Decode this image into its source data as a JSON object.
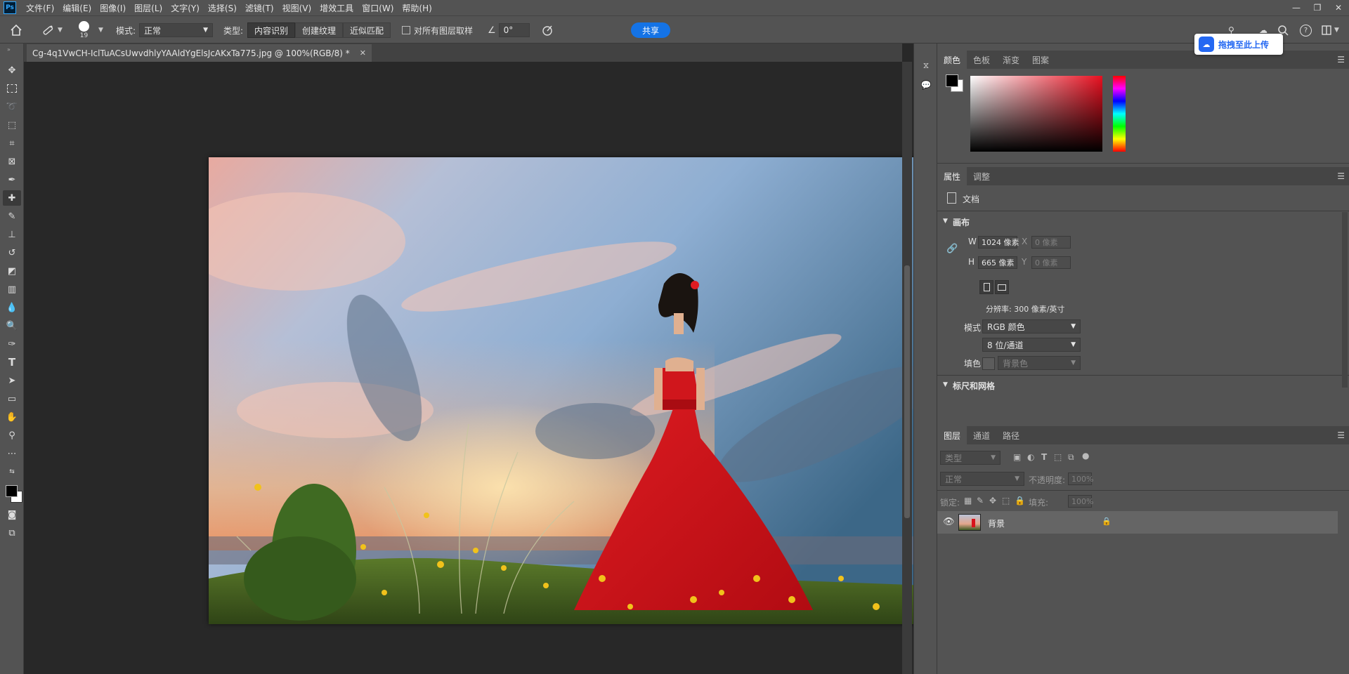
{
  "app": {
    "logo": "Ps"
  },
  "menu": [
    "文件(F)",
    "编辑(E)",
    "图像(I)",
    "图层(L)",
    "文字(Y)",
    "选择(S)",
    "滤镜(T)",
    "视图(V)",
    "增效工具",
    "窗口(W)",
    "帮助(H)"
  ],
  "window_controls": {
    "minimize": "—",
    "restore": "❐",
    "close": "✕"
  },
  "options": {
    "brush_size": "19",
    "mode_label": "模式:",
    "mode_value": "正常",
    "type_label": "类型:",
    "type_buttons": [
      "内容识别",
      "创建纹理",
      "近似匹配"
    ],
    "sample_all_label": "对所有图层取样",
    "angle_value": "0°",
    "share_label": "共享"
  },
  "document": {
    "tab_title": "Cg-4q1VwCH-IclTuACsUwvdhlyYAAldYgElsJcAKxTa775.jpg @ 100%(RGB/8) *",
    "close_glyph": "✕"
  },
  "overlay": {
    "baidu_label": "拖拽至此上传"
  },
  "color_panel": {
    "tabs": [
      "颜色",
      "色板",
      "渐变",
      "图案"
    ],
    "foreground": "#000000",
    "background": "#ffffff"
  },
  "properties_panel": {
    "tabs": [
      "属性",
      "调整"
    ],
    "doc_label": "文档",
    "canvas_section": "画布",
    "w_label": "W",
    "w_value": "1024 像素",
    "h_label": "H",
    "h_value": "665 像素",
    "x_label": "X",
    "x_placeholder": "0 像素",
    "y_label": "Y",
    "y_placeholder": "0 像素",
    "resolution": "分辨率: 300 像素/英寸",
    "mode_label": "模式",
    "mode_value": "RGB 颜色",
    "depth_value": "8 位/通道",
    "fill_label": "填色",
    "fill_value": "背景色",
    "rulers_section": "标尺和网格"
  },
  "layers_panel": {
    "tabs": [
      "图层",
      "通道",
      "路径"
    ],
    "filter_placeholder": "类型",
    "blend_mode": "正常",
    "opacity_label": "不透明度:",
    "opacity_value": "100%",
    "lock_label": "锁定:",
    "fill_label": "填充:",
    "fill_value": "100%",
    "layers": [
      {
        "name": "背景",
        "visible": true,
        "locked": true
      }
    ]
  },
  "colors": {
    "accent": "#1473e6",
    "panel": "#535353",
    "canvas_bg": "#282828",
    "dress": "#d8141c"
  }
}
